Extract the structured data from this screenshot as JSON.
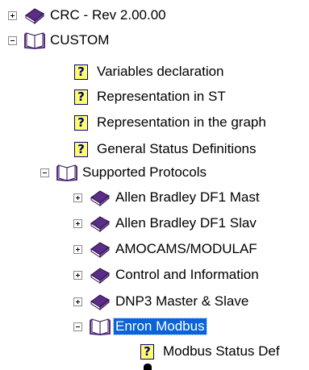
{
  "tree": {
    "items": [
      {
        "label": "CRC - Rev 2.00.00",
        "state": "collapsed",
        "icon": "closed-book-icon"
      },
      {
        "label": "CUSTOM",
        "state": "expanded",
        "icon": "open-book-icon"
      },
      {
        "label": "Variables declaration",
        "icon": "help-topic-icon"
      },
      {
        "label": "Representation in ST",
        "icon": "help-topic-icon"
      },
      {
        "label": "Representation in the graph",
        "icon": "help-topic-icon"
      },
      {
        "label": "General Status Definitions",
        "icon": "help-topic-icon"
      },
      {
        "label": "Supported Protocols",
        "state": "expanded",
        "icon": "open-book-icon"
      },
      {
        "label": "Allen Bradley DF1 Mast",
        "state": "collapsed",
        "icon": "closed-book-icon"
      },
      {
        "label": "Allen Bradley DF1 Slav",
        "state": "collapsed",
        "icon": "closed-book-icon"
      },
      {
        "label": "AMOCAMS/MODULAF",
        "state": "collapsed",
        "icon": "closed-book-icon"
      },
      {
        "label": "Control and Information",
        "state": "collapsed",
        "icon": "closed-book-icon"
      },
      {
        "label": "DNP3 Master & Slave",
        "state": "collapsed",
        "icon": "closed-book-icon"
      },
      {
        "label": "Enron Modbus",
        "state": "expanded",
        "selected": true,
        "icon": "open-book-icon"
      },
      {
        "label": "Modbus Status Def",
        "icon": "help-topic-icon"
      }
    ],
    "help_glyph": "?",
    "colors": {
      "selection": "#0a64d8",
      "book_cover": "#5a2d86",
      "help_bg": "#ffff66"
    }
  }
}
